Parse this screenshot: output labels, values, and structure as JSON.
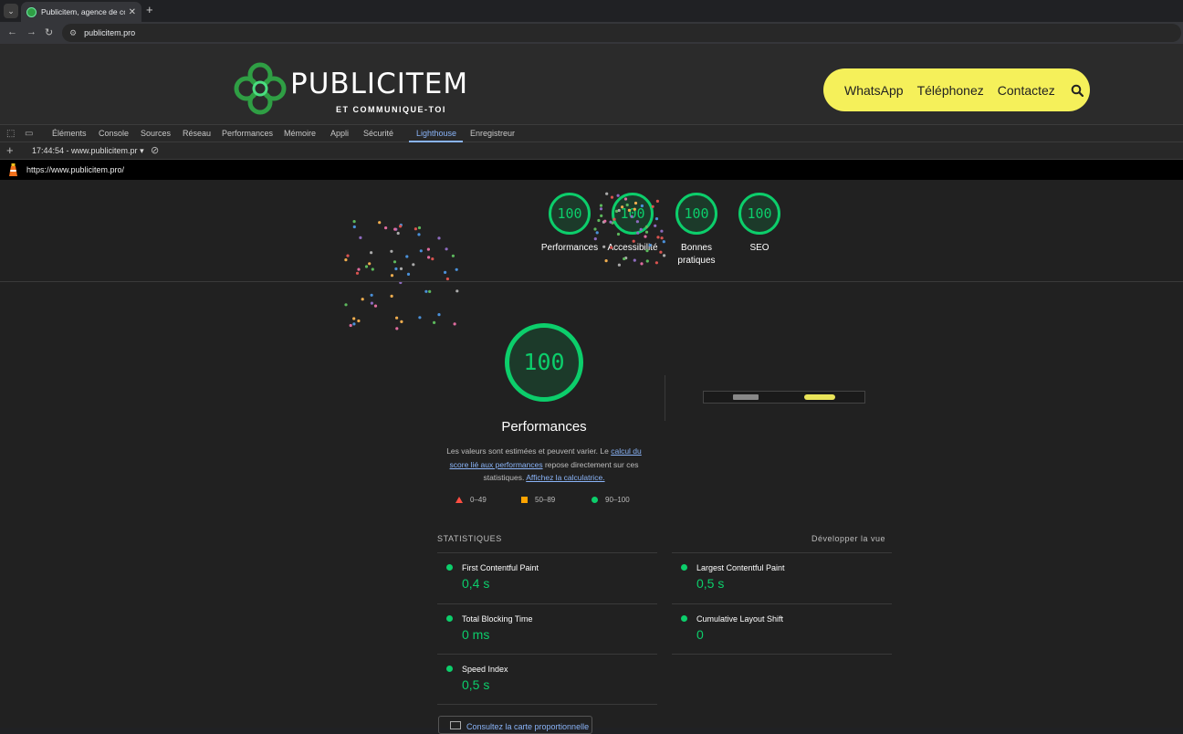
{
  "browser": {
    "tab_title": "Publicitem, agence de communication",
    "new_tab": "+",
    "close": "✕",
    "menu": "⌄",
    "url": "publicitem.pro"
  },
  "site": {
    "logo_text": "PUBLICITEM",
    "logo_sub": "ET COMMUNIQUE-TOI",
    "cta": [
      "WhatsApp",
      "Téléphonez",
      "Contactez"
    ],
    "brand_yellow": "#f5f05a"
  },
  "devtools": {
    "tabs": [
      "Éléments",
      "Console",
      "Sources",
      "Réseau",
      "Performances",
      "Mémoire",
      "Appli",
      "Sécurité",
      "Lighthouse",
      "Enregistreur"
    ],
    "active_tab": "Lighthouse",
    "report_selector": "17:44:54 - www.publicitem.pr",
    "report_url": "https://www.publicitem.pro/"
  },
  "scores": [
    {
      "label": "Performances",
      "value": "100"
    },
    {
      "label": "Accessibilité",
      "value": "100"
    },
    {
      "label": "Bonnes pratiques",
      "value": "100"
    },
    {
      "label": "SEO",
      "value": "100"
    }
  ],
  "performance": {
    "score": "100",
    "title": "Performances",
    "desc_1": "Les valeurs sont estimées et peuvent varier. Le ",
    "desc_link_1": "calcul du score lié aux performances",
    "desc_2": " repose directement sur ces statistiques. ",
    "desc_link_2": "Affichez la calculatrice.",
    "legend": [
      "0–49",
      "50–89",
      "90–100"
    ],
    "good_color": "#0cce6b"
  },
  "stats": {
    "heading": "STATISTIQUES",
    "expand": "Développer la vue",
    "metrics": [
      {
        "name": "First Contentful Paint",
        "value": "0,4 s"
      },
      {
        "name": "Largest Contentful Paint",
        "value": "0,5 s"
      },
      {
        "name": "Total Blocking Time",
        "value": "0 ms"
      },
      {
        "name": "Cumulative Layout Shift",
        "value": "0"
      },
      {
        "name": "Speed Index",
        "value": "0,5 s"
      }
    ],
    "treemap": "Consultez la carte proportionnelle"
  }
}
